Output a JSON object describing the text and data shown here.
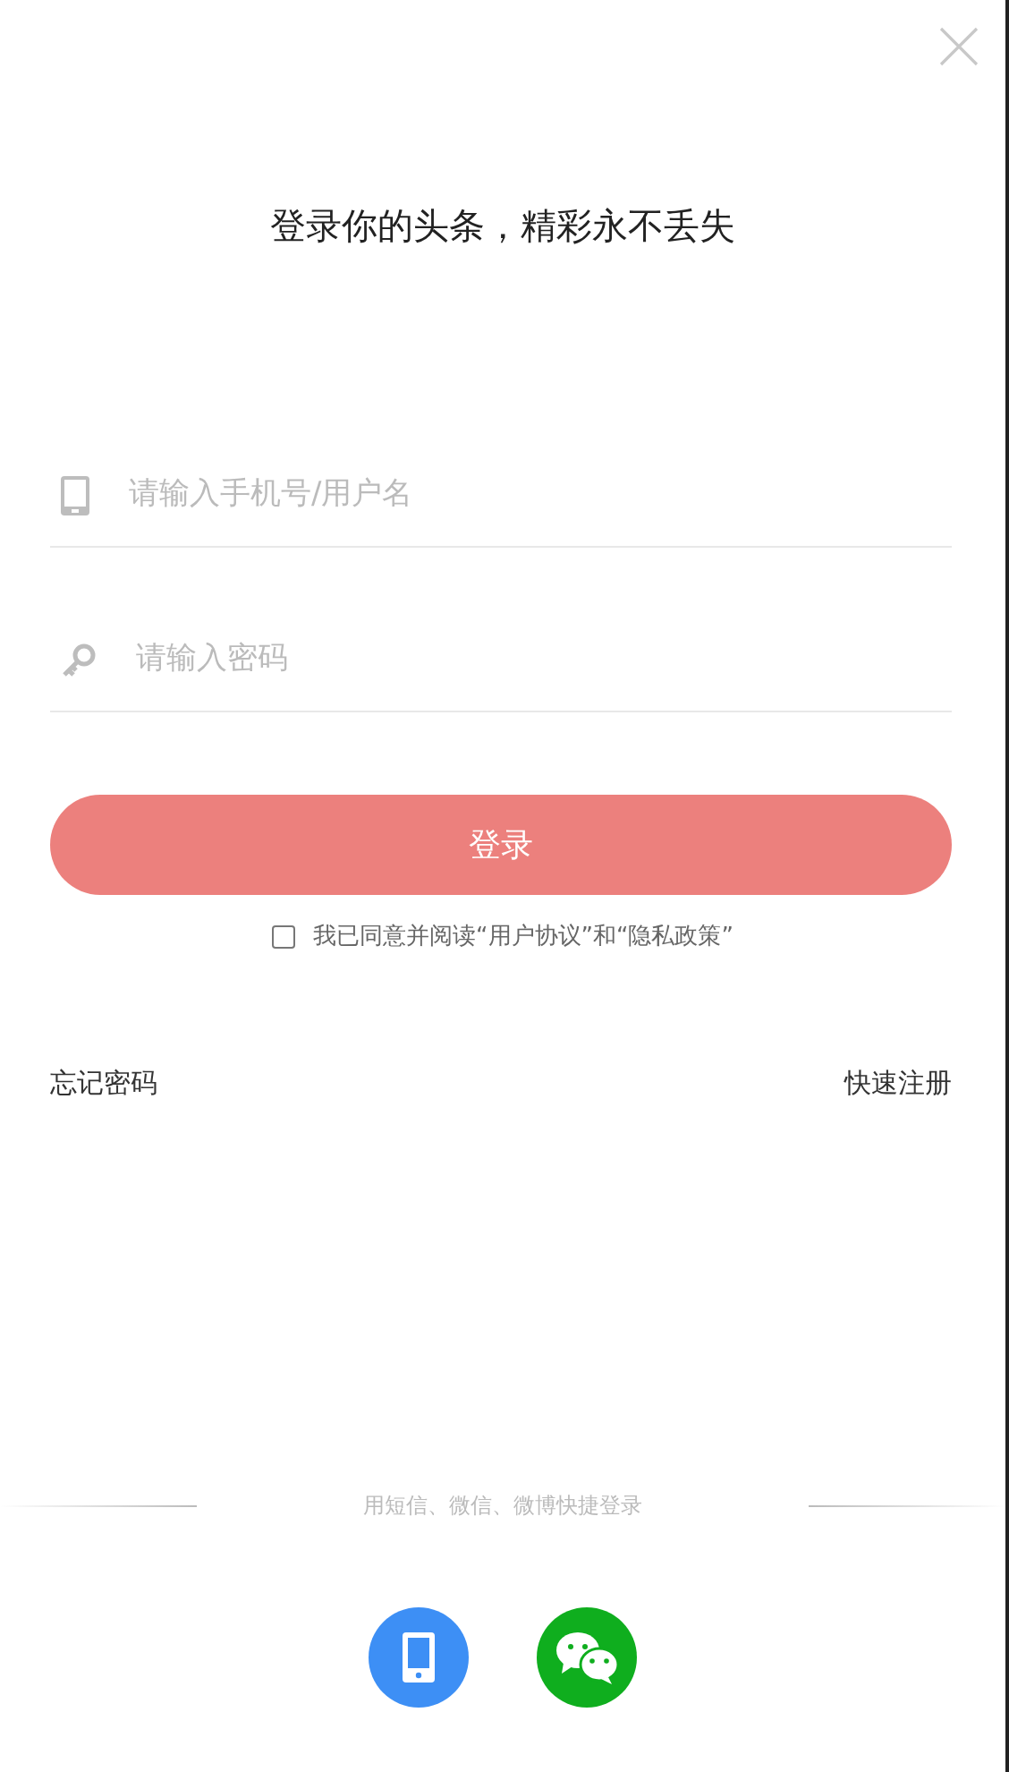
{
  "title": "登录你的头条，精彩永不丢失",
  "fields": [
    {
      "kind": "phone",
      "placeholder": "请输入手机号/用户名"
    },
    {
      "kind": "password",
      "placeholder": "请输入密码"
    }
  ],
  "login_button": "登录",
  "agreement": {
    "label": "我已同意并阅读“用户协议”和“隐私政策”",
    "checked": false
  },
  "links": [
    "忘记密码",
    "快速注册"
  ],
  "quick_login": {
    "label": "用短信、微信、微博快捷登录",
    "options": [
      {
        "kind": "sms"
      },
      {
        "kind": "wechat"
      }
    ]
  }
}
